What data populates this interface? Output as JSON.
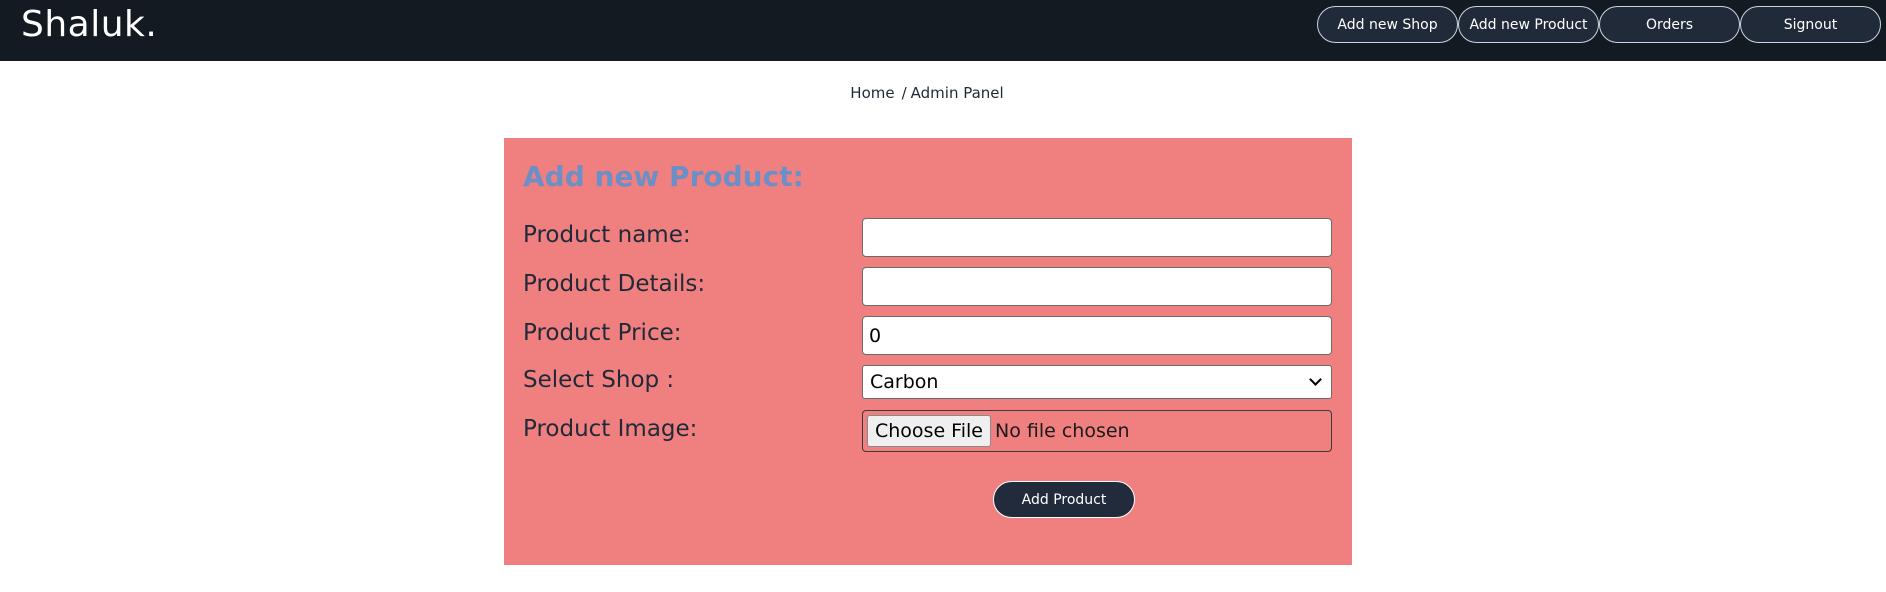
{
  "header": {
    "brand": "Shaluk.",
    "nav": [
      {
        "label": "Add new Shop"
      },
      {
        "label": "Add new Product"
      },
      {
        "label": "Orders"
      },
      {
        "label": "Signout"
      }
    ]
  },
  "breadcrumb": {
    "home": "Home",
    "separator": "/",
    "current": "Admin Panel"
  },
  "form": {
    "title": "Add new Product:",
    "fields": {
      "name": {
        "label": "Product name:",
        "value": ""
      },
      "details": {
        "label": "Product Details:",
        "value": ""
      },
      "price": {
        "label": "Product Price:",
        "value": "0"
      },
      "shop": {
        "label": "Select Shop :",
        "selected": "Carbon"
      },
      "image": {
        "label": "Product Image:",
        "button": "Choose File",
        "status": "No file chosen"
      }
    },
    "submit": "Add Product"
  },
  "colors": {
    "header_bg": "#131a22",
    "panel_bg": "#f08080",
    "title": "#6b8fc6",
    "button_bg": "#222b3b"
  }
}
